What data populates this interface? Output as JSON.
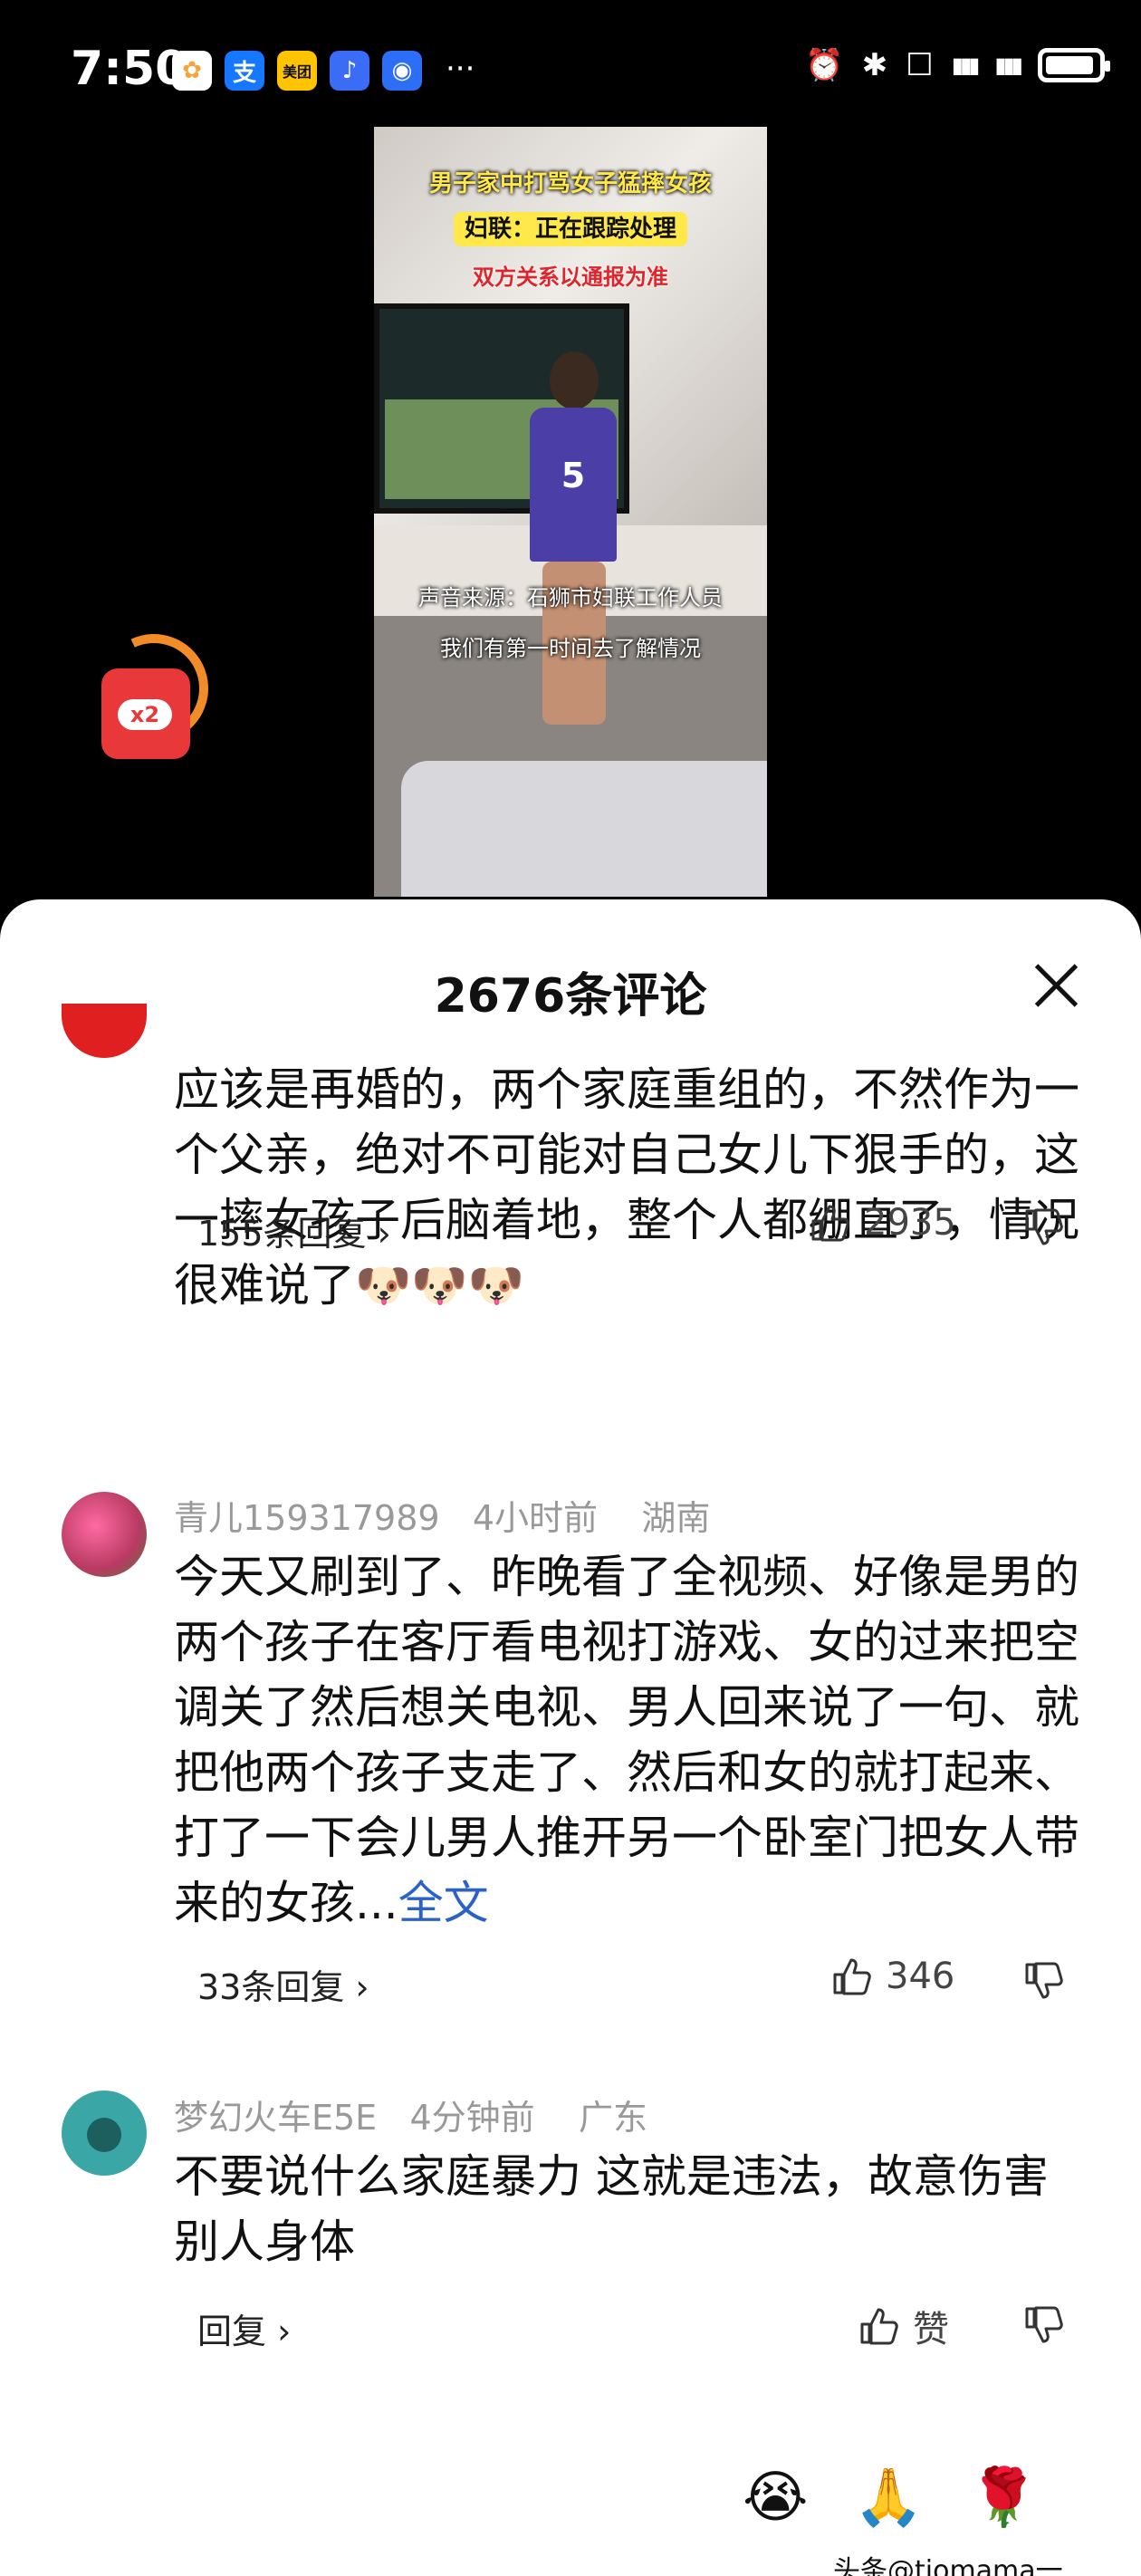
{
  "status_bar": {
    "time": "7:50",
    "apps": [
      {
        "name": "photos-app-icon",
        "glyph": "✿",
        "color": "#f2b53a"
      },
      {
        "name": "alipay-app-icon",
        "glyph": "支",
        "color": "#1677ff"
      },
      {
        "name": "meituan-app-icon",
        "glyph": "美团",
        "color": "#ffc300"
      },
      {
        "name": "voice-app-icon",
        "glyph": "♪",
        "color": "#3a6cf6"
      },
      {
        "name": "browser-app-icon",
        "glyph": "◉",
        "color": "#2d6ef7"
      }
    ],
    "more": "···",
    "icons": [
      "⏰",
      "✱",
      "☐",
      "▮▮▮",
      "▮▮▮"
    ]
  },
  "video": {
    "title_line1": "男子家中打骂女子猛摔女孩",
    "title_line2": "妇联：正在跟踪处理",
    "title_line3": "双方关系以通报为准",
    "jersey_number": "5",
    "subtitle_line1": "声音来源：石狮市妇联工作人员",
    "subtitle_line2": "我们有第一时间去了解情况"
  },
  "floating_redpacket": {
    "label": "x2"
  },
  "comments_panel": {
    "title": "2676条评论",
    "comments": [
      {
        "text": "应该是再婚的，两个家庭重组的，不然作为一个父亲，绝对不可能对自己女儿下狠手的，这一摔女孩子后脑着地，整个人都绷直了，情况很难说了🐶🐶🐶",
        "replies": "155条回复 ›",
        "likes": "2935"
      },
      {
        "user": "青儿159317989",
        "time": "4小时前",
        "location": "湖南",
        "text": "今天又刷到了、昨晚看了全视频、好像是男的两个孩子在客厅看电视打游戏、女的过来把空调关了然后想关电视、男人回来说了一句、就把他两个孩子支走了、然后和女的就打起来、打了一下会儿男人推开另一个卧室门把女人带来的女孩...",
        "more": "全文",
        "replies": "33条回复 ›",
        "likes": "346"
      },
      {
        "user": "梦幻火车E5E",
        "time": "4分钟前",
        "location": "广东",
        "text": "不要说什么家庭暴力 这就是违法，故意伤害别人身体",
        "replies": "回复 ›",
        "likes": "赞"
      }
    ],
    "quick_emojis": [
      "😭",
      "🙏",
      "🌹"
    ],
    "watermark": "头条@tiomama一"
  }
}
